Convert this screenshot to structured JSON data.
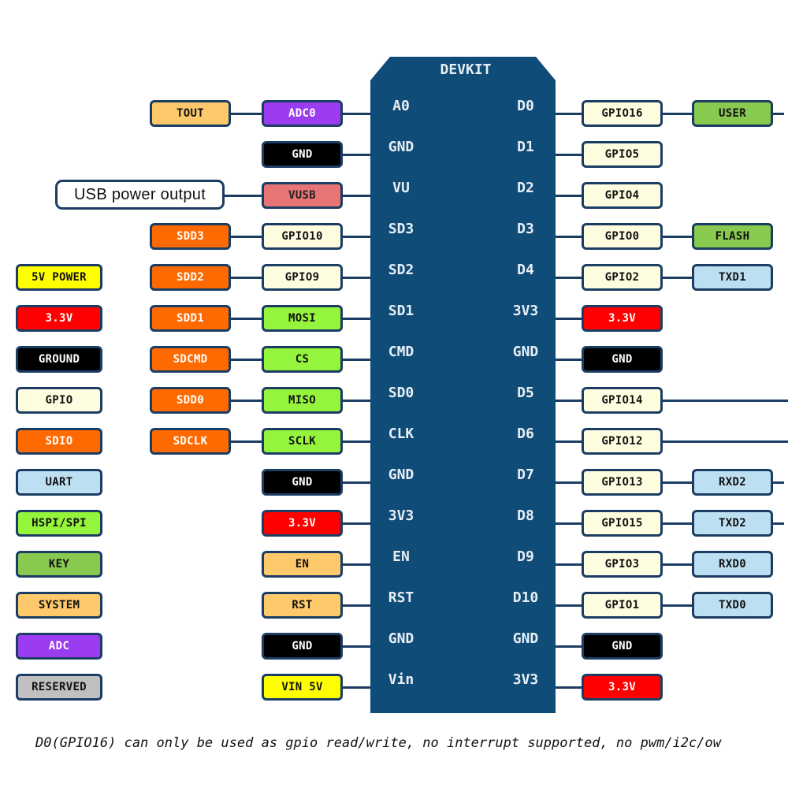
{
  "chip_title": "DEVKIT",
  "border_color": "#1b3d63",
  "chip_color": "#0f4c77",
  "palette": {
    "system": {
      "bg": "#fdc96b",
      "fg": "#111"
    },
    "adc": {
      "bg": "#9b3cf0",
      "fg": "#fff"
    },
    "ground": {
      "bg": "#000000",
      "fg": "#fff"
    },
    "vusb": {
      "bg": "#e87575",
      "fg": "#222"
    },
    "sdio": {
      "bg": "#ff6a00",
      "fg": "#fff"
    },
    "gpio": {
      "bg": "#fefde0",
      "fg": "#111"
    },
    "hspi": {
      "bg": "#95f53c",
      "fg": "#111"
    },
    "key": {
      "bg": "#88c94f",
      "fg": "#111"
    },
    "uart": {
      "bg": "#bddff2",
      "fg": "#111"
    },
    "v33": {
      "bg": "#ff0000",
      "fg": "#fff"
    },
    "v5": {
      "bg": "#ffff00",
      "fg": "#111"
    },
    "reserved": {
      "bg": "#c0c0c0",
      "fg": "#111"
    },
    "note": {
      "bg": "#ffffff",
      "fg": "#111"
    }
  },
  "legend": [
    {
      "label": "5V POWER",
      "type": "v5"
    },
    {
      "label": "3.3V",
      "type": "v33"
    },
    {
      "label": "GROUND",
      "type": "ground"
    },
    {
      "label": "GPIO",
      "type": "gpio"
    },
    {
      "label": "SDIO",
      "type": "sdio"
    },
    {
      "label": "UART",
      "type": "uart"
    },
    {
      "label": "HSPI/SPI",
      "type": "hspi"
    },
    {
      "label": "KEY",
      "type": "key"
    },
    {
      "label": "SYSTEM",
      "type": "system"
    },
    {
      "label": "ADC",
      "type": "adc"
    },
    {
      "label": "RESERVED",
      "type": "reserved"
    }
  ],
  "rows": [
    {
      "left_pin": "A0",
      "right_pin": "D0",
      "a": {
        "label": "TOUT",
        "type": "system"
      },
      "b": {
        "label": "ADC0",
        "type": "adc"
      },
      "c": {
        "label": "GPIO16",
        "type": "gpio"
      },
      "d": {
        "label": "USER",
        "type": "key"
      },
      "extend": true
    },
    {
      "left_pin": "GND",
      "right_pin": "D1",
      "b": {
        "label": "GND",
        "type": "ground"
      },
      "c": {
        "label": "GPIO5",
        "type": "gpio"
      }
    },
    {
      "left_pin": "VU",
      "right_pin": "D2",
      "note": {
        "label": "USB power output",
        "type": "note"
      },
      "b": {
        "label": "VUSB",
        "type": "vusb"
      },
      "c": {
        "label": "GPIO4",
        "type": "gpio"
      }
    },
    {
      "left_pin": "SD3",
      "right_pin": "D3",
      "a": {
        "label": "SDD3",
        "type": "sdio"
      },
      "b": {
        "label": "GPIO10",
        "type": "gpio"
      },
      "c": {
        "label": "GPIO0",
        "type": "gpio"
      },
      "d": {
        "label": "FLASH",
        "type": "key"
      }
    },
    {
      "left_pin": "SD2",
      "right_pin": "D4",
      "a": {
        "label": "SDD2",
        "type": "sdio"
      },
      "b": {
        "label": "GPIO9",
        "type": "gpio"
      },
      "c": {
        "label": "GPIO2",
        "type": "gpio"
      },
      "d": {
        "label": "TXD1",
        "type": "uart"
      }
    },
    {
      "left_pin": "SD1",
      "right_pin": "3V3",
      "a": {
        "label": "SDD1",
        "type": "sdio"
      },
      "b": {
        "label": "MOSI",
        "type": "hspi"
      },
      "c": {
        "label": "3.3V",
        "type": "v33"
      }
    },
    {
      "left_pin": "CMD",
      "right_pin": "GND",
      "a": {
        "label": "SDCMD",
        "type": "sdio"
      },
      "b": {
        "label": "CS",
        "type": "hspi"
      },
      "c": {
        "label": "GND",
        "type": "ground"
      }
    },
    {
      "left_pin": "SD0",
      "right_pin": "D5",
      "a": {
        "label": "SDD0",
        "type": "sdio"
      },
      "b": {
        "label": "MISO",
        "type": "hspi"
      },
      "c": {
        "label": "GPIO14",
        "type": "gpio"
      },
      "extend": true
    },
    {
      "left_pin": "CLK",
      "right_pin": "D6",
      "a": {
        "label": "SDCLK",
        "type": "sdio"
      },
      "b": {
        "label": "SCLK",
        "type": "hspi"
      },
      "c": {
        "label": "GPIO12",
        "type": "gpio"
      },
      "extend": true
    },
    {
      "left_pin": "GND",
      "right_pin": "D7",
      "b": {
        "label": "GND",
        "type": "ground"
      },
      "c": {
        "label": "GPIO13",
        "type": "gpio"
      },
      "d": {
        "label": "RXD2",
        "type": "uart"
      },
      "extend": true
    },
    {
      "left_pin": "3V3",
      "right_pin": "D8",
      "b": {
        "label": "3.3V",
        "type": "v33"
      },
      "c": {
        "label": "GPIO15",
        "type": "gpio"
      },
      "d": {
        "label": "TXD2",
        "type": "uart"
      },
      "extend": true
    },
    {
      "left_pin": "EN",
      "right_pin": "D9",
      "b": {
        "label": "EN",
        "type": "system"
      },
      "c": {
        "label": "GPIO3",
        "type": "gpio"
      },
      "d": {
        "label": "RXD0",
        "type": "uart"
      }
    },
    {
      "left_pin": "RST",
      "right_pin": "D10",
      "b": {
        "label": "RST",
        "type": "system"
      },
      "c": {
        "label": "GPIO1",
        "type": "gpio"
      },
      "d": {
        "label": "TXD0",
        "type": "uart"
      }
    },
    {
      "left_pin": "GND",
      "right_pin": "GND",
      "b": {
        "label": "GND",
        "type": "ground"
      },
      "c": {
        "label": "GND",
        "type": "ground"
      }
    },
    {
      "left_pin": "Vin",
      "right_pin": "3V3",
      "b": {
        "label": "VIN 5V",
        "type": "v5"
      },
      "c": {
        "label": "3.3V",
        "type": "v33"
      }
    }
  ],
  "footnote": "D0(GPIO16) can only be used as gpio read/write, no interrupt supported, no pwm/i2c/ow"
}
